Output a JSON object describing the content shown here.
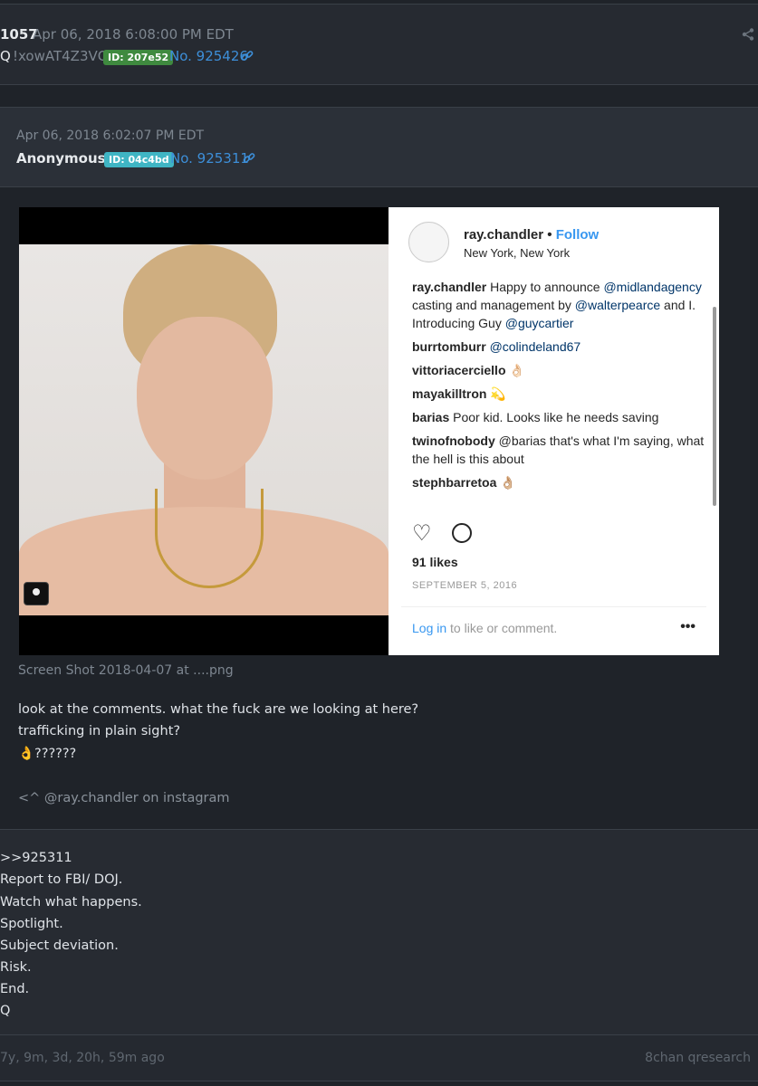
{
  "post1": {
    "num_fragment": "1057",
    "date": "Apr 06, 2018 6:08:00 PM EDT",
    "name": "Q",
    "tripcode": "!xowAT4Z3VQ",
    "id_badge": "ID: 207e52",
    "id_color": "#3f8a3f",
    "post_no": "No. 925426",
    "icons": [
      "link-icon",
      "share-icon"
    ]
  },
  "post2": {
    "date": "Apr 06, 2018 6:02:07 PM EDT",
    "name": "Anonymous",
    "id_badge": "ID: 04c4bd",
    "id_color": "#3fb5c4",
    "post_no": "No. 925311",
    "filename": "Screen Shot 2018-04-07 at ....png",
    "body": [
      "look at the comments. what the fuck are we looking at here?",
      "trafficking in plain sight?",
      "👌??????"
    ],
    "footnote": "<^ @ray.chandler on instagram"
  },
  "instagram": {
    "username": "ray.chandler",
    "bullet": "•",
    "follow": "Follow",
    "location": "New York, New York",
    "caption_user": "ray.chandler",
    "caption": [
      {
        "text": " Happy to announce "
      },
      {
        "mention": "@midlandagency"
      },
      {
        "text": " casting and management by "
      },
      {
        "mention": "@walterpearce"
      },
      {
        "text": " and I. Introducing Guy "
      },
      {
        "mention": "@guycartier"
      }
    ],
    "comments": [
      {
        "user": "burrtomburr",
        "text": "@colindeland67"
      },
      {
        "user": "vittoriacerciello",
        "text": "👌🏻"
      },
      {
        "user": "mayakilltron",
        "text": "💫"
      },
      {
        "user": "barias",
        "text": "Poor kid. Looks like he needs saving"
      },
      {
        "user": "twinofnobody",
        "text": "@barias that's what I'm saying, what the hell is this about"
      },
      {
        "user": "stephbarretoa",
        "text": "👌🏼"
      }
    ],
    "likes": "91 likes",
    "date": "SEPTEMBER 5, 2016",
    "login_link": "Log in",
    "login_rest": " to like or comment.",
    "more": "•••"
  },
  "reply": {
    "lines": [
      ">>925311",
      "Report to FBI/ DOJ.",
      "Watch what happens.",
      "Spotlight.",
      "Subject deviation.",
      "Risk.",
      "End.",
      "Q"
    ]
  },
  "footer": {
    "age": "7y, 9m, 3d, 20h, 59m ago",
    "source": "8chan qresearch"
  }
}
